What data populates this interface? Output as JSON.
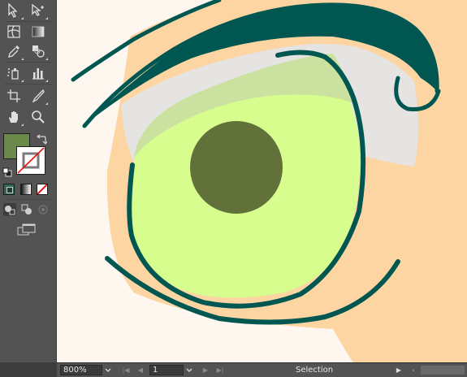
{
  "toolbar": {
    "tools": [
      {
        "name": "direct-selection-tool"
      },
      {
        "name": "group-selection-tool"
      },
      {
        "name": "mesh-tool"
      },
      {
        "name": "gradient-tool"
      },
      {
        "name": "eyedropper-tool"
      },
      {
        "name": "blend-tool"
      },
      {
        "name": "symbol-sprayer-tool"
      },
      {
        "name": "column-graph-tool"
      },
      {
        "name": "artboard-tool"
      },
      {
        "name": "slice-tool"
      },
      {
        "name": "hand-tool"
      },
      {
        "name": "zoom-tool"
      }
    ],
    "fill_color": "#6b8a4a",
    "stroke_color": "none",
    "swap_icon": "swap-arrows-icon",
    "default_colors_icon": "default-fill-stroke-icon",
    "color_mode": [
      "color",
      "gradient",
      "none"
    ],
    "draw_modes": [
      "draw-normal",
      "draw-behind",
      "draw-inside"
    ],
    "screen_mode_icon": "change-screen-mode-icon"
  },
  "artwork": {
    "colors": {
      "skin": "#fcd5a3",
      "eye_white": "#fef7ef",
      "sclera_shadow": "#e6e4e2",
      "iris": "#d6fd8e",
      "iris_shadow": "#cbe1a0",
      "pupil": "#627039",
      "outline": "#005650",
      "lash": "#005650"
    }
  },
  "statusbar": {
    "zoom": "800%",
    "page": "1",
    "status": "Selection"
  }
}
